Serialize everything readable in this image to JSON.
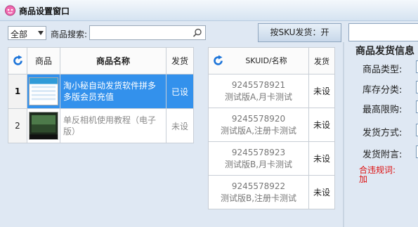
{
  "window": {
    "title": "商品设置窗口"
  },
  "toolbar": {
    "filter_value": "全部",
    "search_label": "商品搜索:",
    "search_value": "",
    "sku_toggle_label": "按SKU发货：开"
  },
  "product_table": {
    "headers": {
      "image": "商品",
      "name": "商品名称",
      "status": "发货"
    },
    "rows": [
      {
        "index": "1",
        "name": "淘小秘自动发货软件拼多多版会员充值",
        "status": "已设",
        "selected": true
      },
      {
        "index": "2",
        "name": "单反相机使用教程（电子版）",
        "status": "未设",
        "selected": false
      }
    ]
  },
  "sku_table": {
    "headers": {
      "sku": "SKUID/名称",
      "status": "发货"
    },
    "rows": [
      {
        "id": "9245578921",
        "name": "测试版A,月卡测试",
        "status": "未设"
      },
      {
        "id": "9245578920",
        "name": "测试版A,注册卡测试",
        "status": "未设"
      },
      {
        "id": "9245578923",
        "name": "测试版B,月卡测试",
        "status": "未设"
      },
      {
        "id": "9245578922",
        "name": "测试版B,注册卡测试",
        "status": "未设"
      }
    ]
  },
  "shipping_info": {
    "heading": "商品发货信息",
    "product_type_label": "商品类型:",
    "stock_category_label": "库存分类:",
    "max_limit_label": "最高限购:",
    "ship_method_label": "发货方式:",
    "ship_note_label": "发货附言:",
    "violation_warning": "合违规词:加"
  },
  "colors": {
    "selected_row": "#3391ec",
    "warning": "#dd1111",
    "window_bg": "#dfe8f3"
  }
}
